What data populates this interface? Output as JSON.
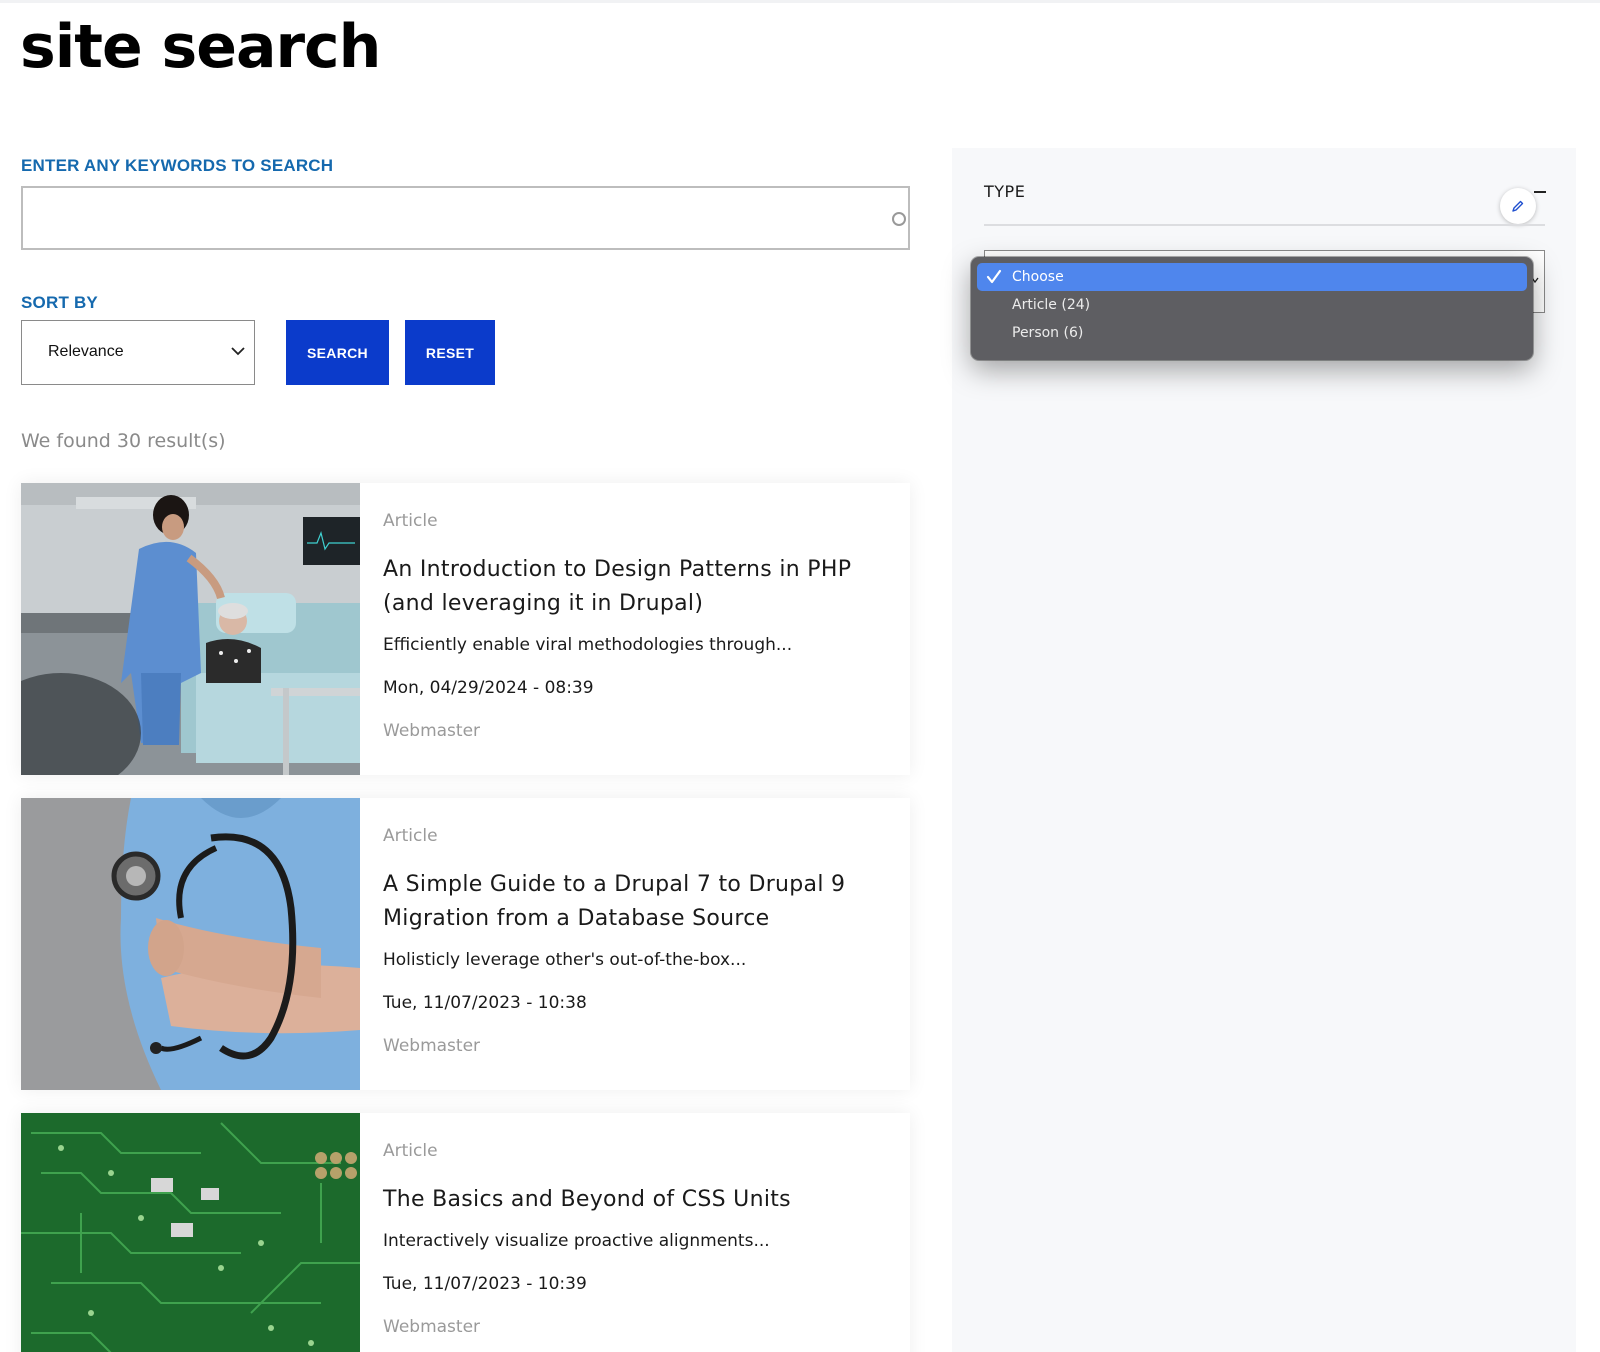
{
  "page": {
    "title": "site search"
  },
  "search": {
    "keywords_label": "ENTER ANY KEYWORDS TO SEARCH",
    "keywords_value": "",
    "sort_label": "SORT BY",
    "sort_value": "Relevance",
    "search_button": "SEARCH",
    "reset_button": "RESET",
    "results_count": "We found 30 result(s)"
  },
  "results": [
    {
      "type": "Article",
      "title": "An Introduction to Design Patterns in PHP (and leveraging it in Drupal)",
      "teaser": "Efficiently enable viral methodologies through...",
      "date": "Mon, 04/29/2024 - 08:39",
      "author": "Webmaster",
      "image": "nurse-with-patient-photo"
    },
    {
      "type": "Article",
      "title": "A Simple Guide to a Drupal 7 to Drupal 9 Migration from a Database Source",
      "teaser": "Holisticly leverage other's out-of-the-box...",
      "date": "Tue, 11/07/2023 - 10:38",
      "author": "Webmaster",
      "image": "stethoscope-arms-photo"
    },
    {
      "type": "Article",
      "title": "The Basics and Beyond of CSS Units",
      "teaser": "Interactively visualize proactive alignments...",
      "date": "Tue, 11/07/2023 - 10:39",
      "author": "Webmaster",
      "image": "circuit-board-photo"
    }
  ],
  "facets": {
    "type_label": "TYPE",
    "edit_icon": "pencil-icon",
    "dropdown": [
      {
        "label": "Choose",
        "selected": true
      },
      {
        "label": "Article (24)",
        "selected": false
      },
      {
        "label": "Person (6)",
        "selected": false
      }
    ]
  },
  "colors": {
    "accent_blue_text": "#1569ae",
    "button_blue": "#0b3bcb",
    "dropdown_bg": "#5e5e62",
    "dropdown_selected": "#4f86ed",
    "sidebar_bg": "#f7f8fa"
  }
}
